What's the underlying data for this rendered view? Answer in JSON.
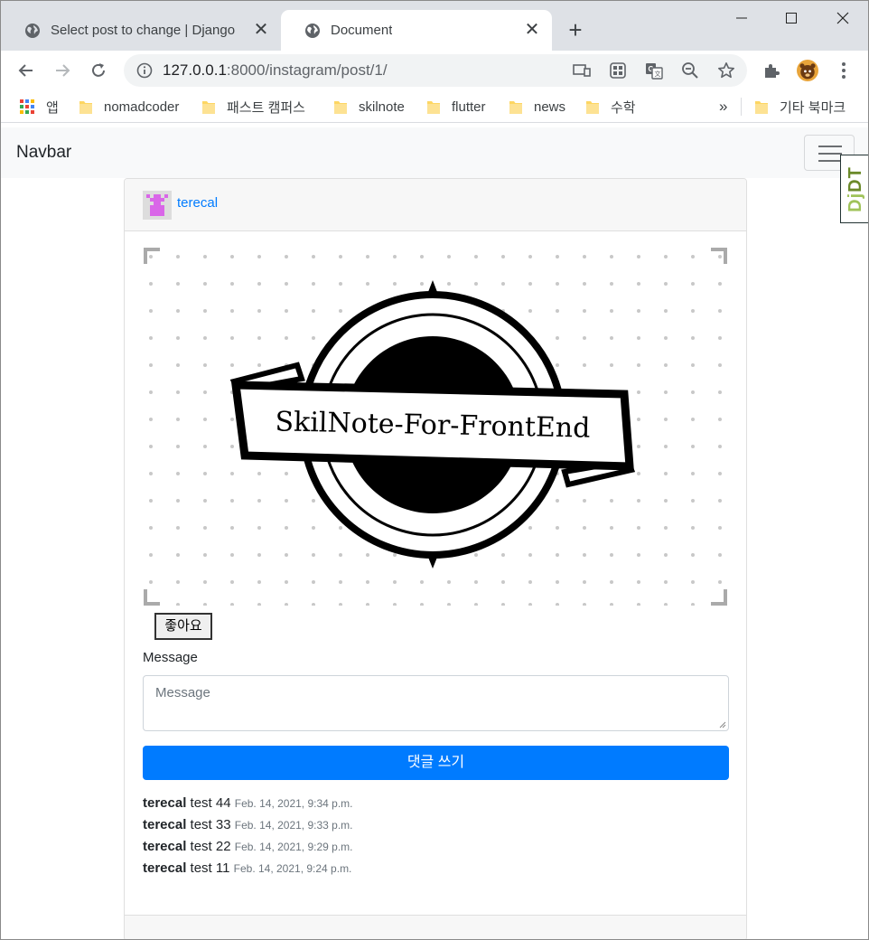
{
  "browser": {
    "tabs": [
      {
        "title": "Select post to change | Django",
        "icon": "globe-icon",
        "close": "✕"
      },
      {
        "title": "Document",
        "icon": "globe-icon",
        "close": "✕"
      }
    ],
    "new_tab": "+",
    "url_host": "127.0.0.1",
    "url_rest": ":8000/instagram/post/1/"
  },
  "bookmarks": {
    "apps_label": "앱",
    "folders": [
      "nomadcoder",
      "패스트 캠퍼스",
      "skilnote",
      "flutter",
      "news",
      "수학"
    ],
    "overflow": "»",
    "other_label": "기타 북마크"
  },
  "navbar": {
    "brand": "Navbar",
    "debug_toolbar": {
      "prefix": "Dj",
      "suffix": "DT"
    }
  },
  "post": {
    "author": "terecal",
    "image_text": "SkilNote-For-FrontEnd",
    "like_button": "좋아요",
    "message_label": "Message",
    "message_placeholder": "Message",
    "submit_button": "댓글 쓰기",
    "comments": [
      {
        "author": "terecal",
        "text": "test 44",
        "date": "Feb. 14, 2021, 9:34 p.m."
      },
      {
        "author": "terecal",
        "text": "test 33",
        "date": "Feb. 14, 2021, 9:33 p.m."
      },
      {
        "author": "terecal",
        "text": "test 22",
        "date": "Feb. 14, 2021, 9:29 p.m."
      },
      {
        "author": "terecal",
        "text": "test 11",
        "date": "Feb. 14, 2021, 9:24 p.m."
      }
    ]
  },
  "colors": {
    "accent": "#007bff",
    "tabstrip": "#dee1e6",
    "navbar_bg": "#f8f9fa",
    "folder": "#fdd663"
  }
}
